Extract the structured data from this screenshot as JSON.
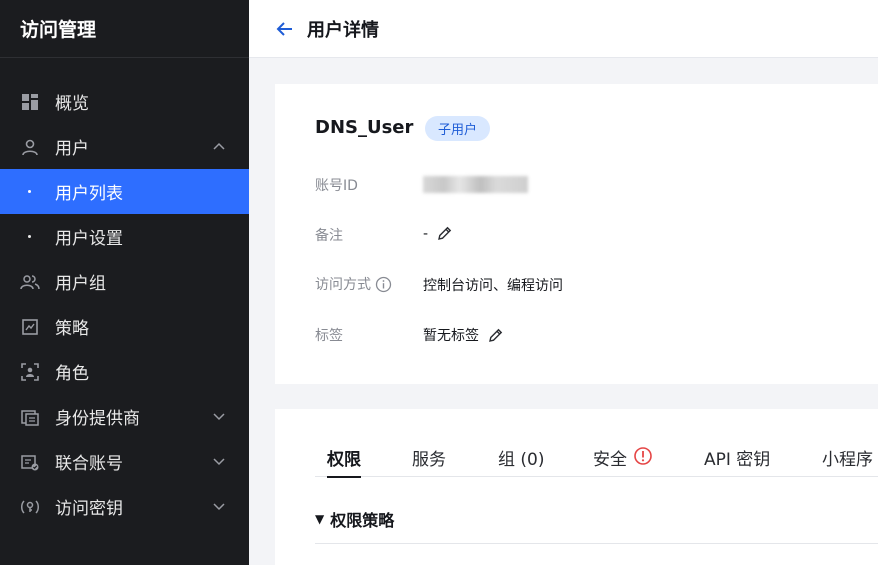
{
  "sidebar": {
    "title": "访问管理",
    "items": [
      {
        "label": "概览",
        "icon": "dashboard-icon"
      },
      {
        "label": "用户",
        "icon": "user-icon",
        "expanded": true
      },
      {
        "label": "用户列表",
        "sub": true,
        "active": true
      },
      {
        "label": "用户设置",
        "sub": true
      },
      {
        "label": "用户组",
        "icon": "user-group-icon"
      },
      {
        "label": "策略",
        "icon": "policy-icon"
      },
      {
        "label": "角色",
        "icon": "role-icon"
      },
      {
        "label": "身份提供商",
        "icon": "identity-provider-icon",
        "expanded": false
      },
      {
        "label": "联合账号",
        "icon": "federated-account-icon",
        "expanded": false
      },
      {
        "label": "访问密钥",
        "icon": "access-key-icon",
        "expanded": false
      }
    ]
  },
  "header": {
    "title": "用户详情",
    "back_icon": "arrow-left-icon"
  },
  "user": {
    "name": "DNS_User",
    "badge": "子用户",
    "fields": {
      "account_id_label": "账号ID",
      "remark_label": "备注",
      "remark_value": "-",
      "access_label": "访问方式",
      "access_value": "控制台访问、编程访问",
      "tags_label": "标签",
      "tags_value": "暂无标签"
    }
  },
  "tabs": [
    {
      "label": "权限",
      "active": true
    },
    {
      "label": "服务"
    },
    {
      "label": "组 (0)"
    },
    {
      "label": "安全",
      "warning": true
    },
    {
      "label": "API 密钥"
    },
    {
      "label": "小程序"
    }
  ],
  "section": {
    "title": "权限策略",
    "collapse_glyph": "▼"
  },
  "colors": {
    "sidebar_bg": "#1b1c1f",
    "accent": "#2e6eff",
    "badge_bg": "#d9e8ff",
    "badge_text": "#1e5cd6",
    "warning": "#e54545",
    "back_arrow": "#1e5cd6"
  }
}
